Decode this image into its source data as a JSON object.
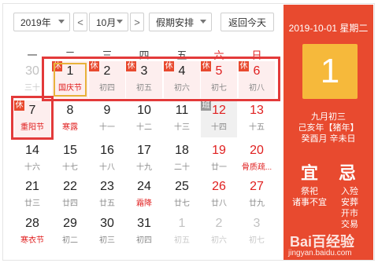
{
  "toolbar": {
    "year": "2019年",
    "prev": "<",
    "month": "10月",
    "next": ">",
    "holiday": "假期安排",
    "today": "返回今天"
  },
  "weekdays": [
    "一",
    "二",
    "三",
    "四",
    "五",
    "六",
    "日"
  ],
  "days": [
    {
      "n": "30",
      "s": "三十"
    },
    {
      "n": "1",
      "s": "国庆节",
      "tag": "休"
    },
    {
      "n": "2",
      "s": "初四",
      "tag": "休"
    },
    {
      "n": "3",
      "s": "初五",
      "tag": "休"
    },
    {
      "n": "4",
      "s": "初六",
      "tag": "休"
    },
    {
      "n": "5",
      "s": "初七",
      "tag": "休"
    },
    {
      "n": "6",
      "s": "初八",
      "tag": "休"
    },
    {
      "n": "7",
      "s": "重阳节",
      "tag": "休"
    },
    {
      "n": "8",
      "s": "寒露"
    },
    {
      "n": "9",
      "s": "十一"
    },
    {
      "n": "10",
      "s": "十二"
    },
    {
      "n": "11",
      "s": "十三"
    },
    {
      "n": "12",
      "s": "十四",
      "tag": "班"
    },
    {
      "n": "13",
      "s": "十五"
    },
    {
      "n": "14",
      "s": "十六"
    },
    {
      "n": "15",
      "s": "十七"
    },
    {
      "n": "16",
      "s": "十八"
    },
    {
      "n": "17",
      "s": "十九"
    },
    {
      "n": "18",
      "s": "二十"
    },
    {
      "n": "19",
      "s": "廿一"
    },
    {
      "n": "20",
      "s": "骨质疏..."
    },
    {
      "n": "21",
      "s": "廿三"
    },
    {
      "n": "22",
      "s": "廿四"
    },
    {
      "n": "23",
      "s": "廿五"
    },
    {
      "n": "24",
      "s": "霜降"
    },
    {
      "n": "25",
      "s": "廿七"
    },
    {
      "n": "26",
      "s": "廿八"
    },
    {
      "n": "27",
      "s": "廿九"
    },
    {
      "n": "28",
      "s": "寒衣节"
    },
    {
      "n": "29",
      "s": "初二"
    },
    {
      "n": "30",
      "s": "初三"
    },
    {
      "n": "31",
      "s": "初四"
    },
    {
      "n": "1",
      "s": "初五"
    },
    {
      "n": "2",
      "s": "初六"
    },
    {
      "n": "3",
      "s": "初七"
    }
  ],
  "side": {
    "date": "2019-10-01 星期二",
    "big": "1",
    "lunar": "九月初三",
    "year_gz": "己亥年【猪年】",
    "month_day_gz": "癸酉月 辛未日",
    "yi": "宜",
    "ji": "忌",
    "yi_items": [
      "祭祀",
      "诸事不宜"
    ],
    "ji_items": [
      "入殓",
      "安葬",
      "开市",
      "交易"
    ],
    "watermark": "Bai百经验",
    "watermark_url": "jingyan.baidu.com"
  },
  "colors": {
    "accent": "#e84a2f",
    "big_box": "#f6b93b",
    "weekend": "#e02020",
    "highlight": "#e33a3a"
  }
}
